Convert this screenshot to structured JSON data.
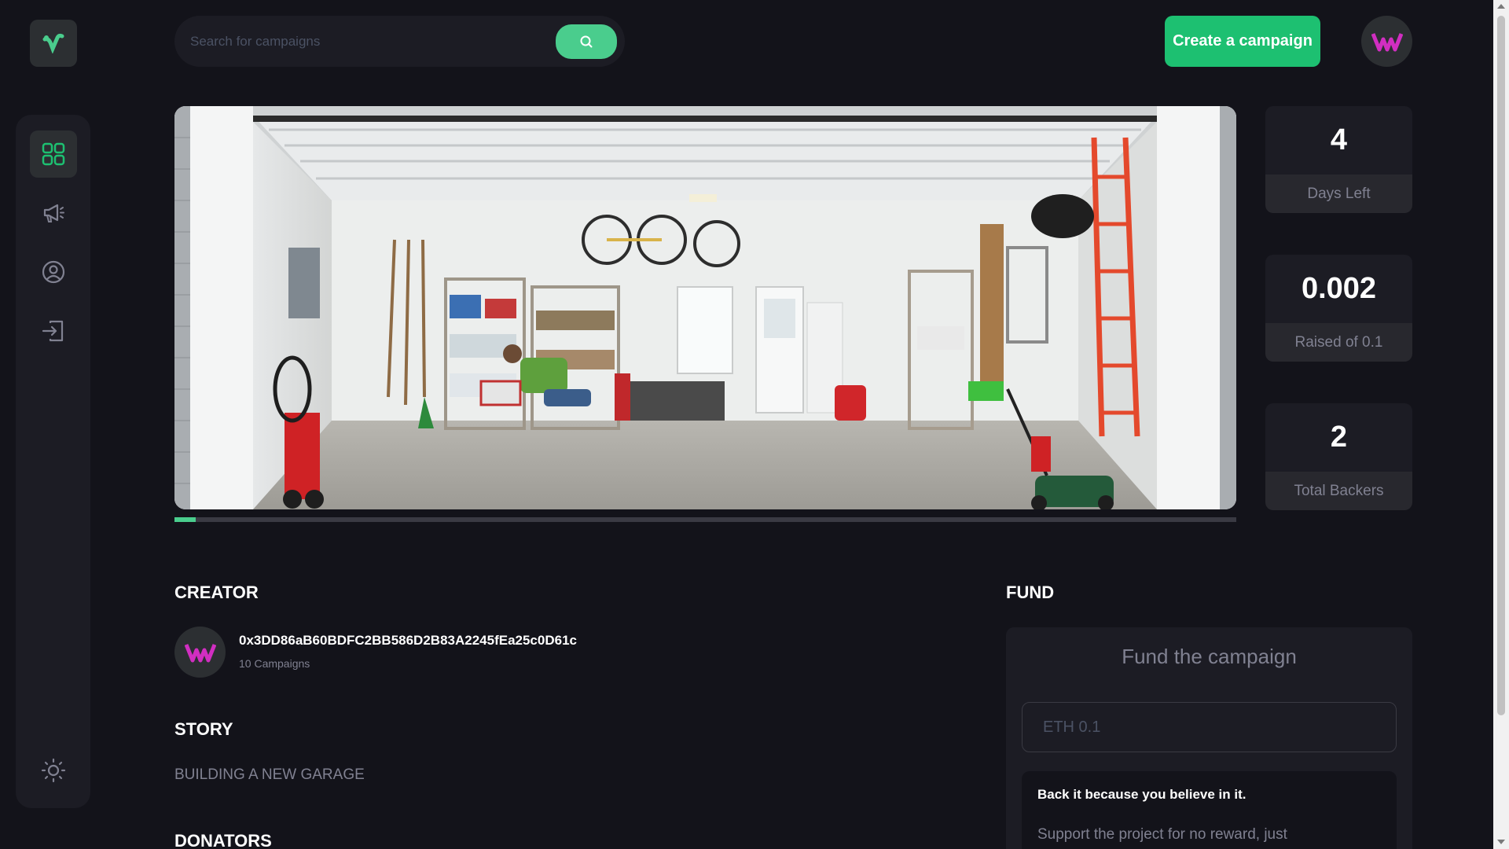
{
  "search": {
    "placeholder": "Search for campaigns"
  },
  "header": {
    "create_label": "Create a campaign"
  },
  "sidebar": {
    "items": [
      {
        "icon": "dashboard-icon",
        "active": true
      },
      {
        "icon": "megaphone-icon",
        "active": false
      },
      {
        "icon": "user-icon",
        "active": false
      },
      {
        "icon": "logout-icon",
        "active": false
      }
    ],
    "theme_icon": "sun-icon"
  },
  "campaign": {
    "progress_percent": 2,
    "stats": [
      {
        "value": "4",
        "label": "Days Left"
      },
      {
        "value": "0.002",
        "label": "Raised of 0.1"
      },
      {
        "value": "2",
        "label": "Total Backers"
      }
    ]
  },
  "creator": {
    "title": "CREATOR",
    "address": "0x3DD86aB60BDFC2BB586D2B83A2245fEa25c0D61c",
    "campaigns": "10 Campaigns"
  },
  "story": {
    "title": "STORY",
    "text": "BUILDING A NEW GARAGE"
  },
  "donators": {
    "title": "DONATORS"
  },
  "fund": {
    "title": "FUND",
    "heading": "Fund the campaign",
    "input_placeholder": "ETH 0.1",
    "note_title": "Back it because you believe in it.",
    "note_body": "Support the project for no reward, just"
  },
  "colors": {
    "background": "#13131a",
    "card": "#1c1c24",
    "accent": "#4acd8d",
    "brand_magenta": "#d12ec1"
  }
}
